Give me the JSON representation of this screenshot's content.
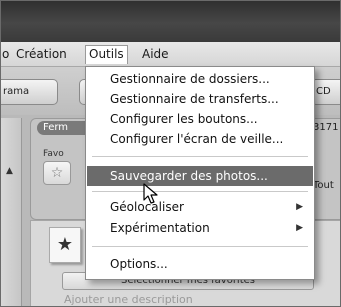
{
  "menubar": {
    "items": [
      "o",
      "Création",
      "Outils",
      "Aide"
    ]
  },
  "toolbar": {
    "left_button": "rama",
    "right_button": "CD"
  },
  "panel": {
    "pill_label": "Ferm",
    "fav_label": "Favo",
    "right_number": "3171",
    "right_text": "Tout"
  },
  "lower": {
    "select_button": "Sélectionner mes favorites",
    "description_placeholder": "Ajouter une description"
  },
  "dropdown": {
    "items": [
      {
        "label": "Gestionnaire de dossiers...",
        "submenu": false
      },
      {
        "label": "Gestionnaire de transferts...",
        "submenu": false
      },
      {
        "label": "Configurer les boutons...",
        "submenu": false
      },
      {
        "label": "Configurer l'écran de veille...",
        "submenu": false
      },
      {
        "label": "Sauvegarder des photos...",
        "submenu": false,
        "highlighted": true
      },
      {
        "label": "Géolocaliser",
        "submenu": true
      },
      {
        "label": "Expérimentation",
        "submenu": true
      },
      {
        "label": "Options...",
        "submenu": false
      }
    ],
    "submenu_arrow": "▶"
  },
  "colors": {
    "highlight": "#6b6b6b",
    "titlebar": "#3a3a3a"
  },
  "icons": {
    "star": "star-icon",
    "cursor": "mouse-pointer-icon"
  }
}
